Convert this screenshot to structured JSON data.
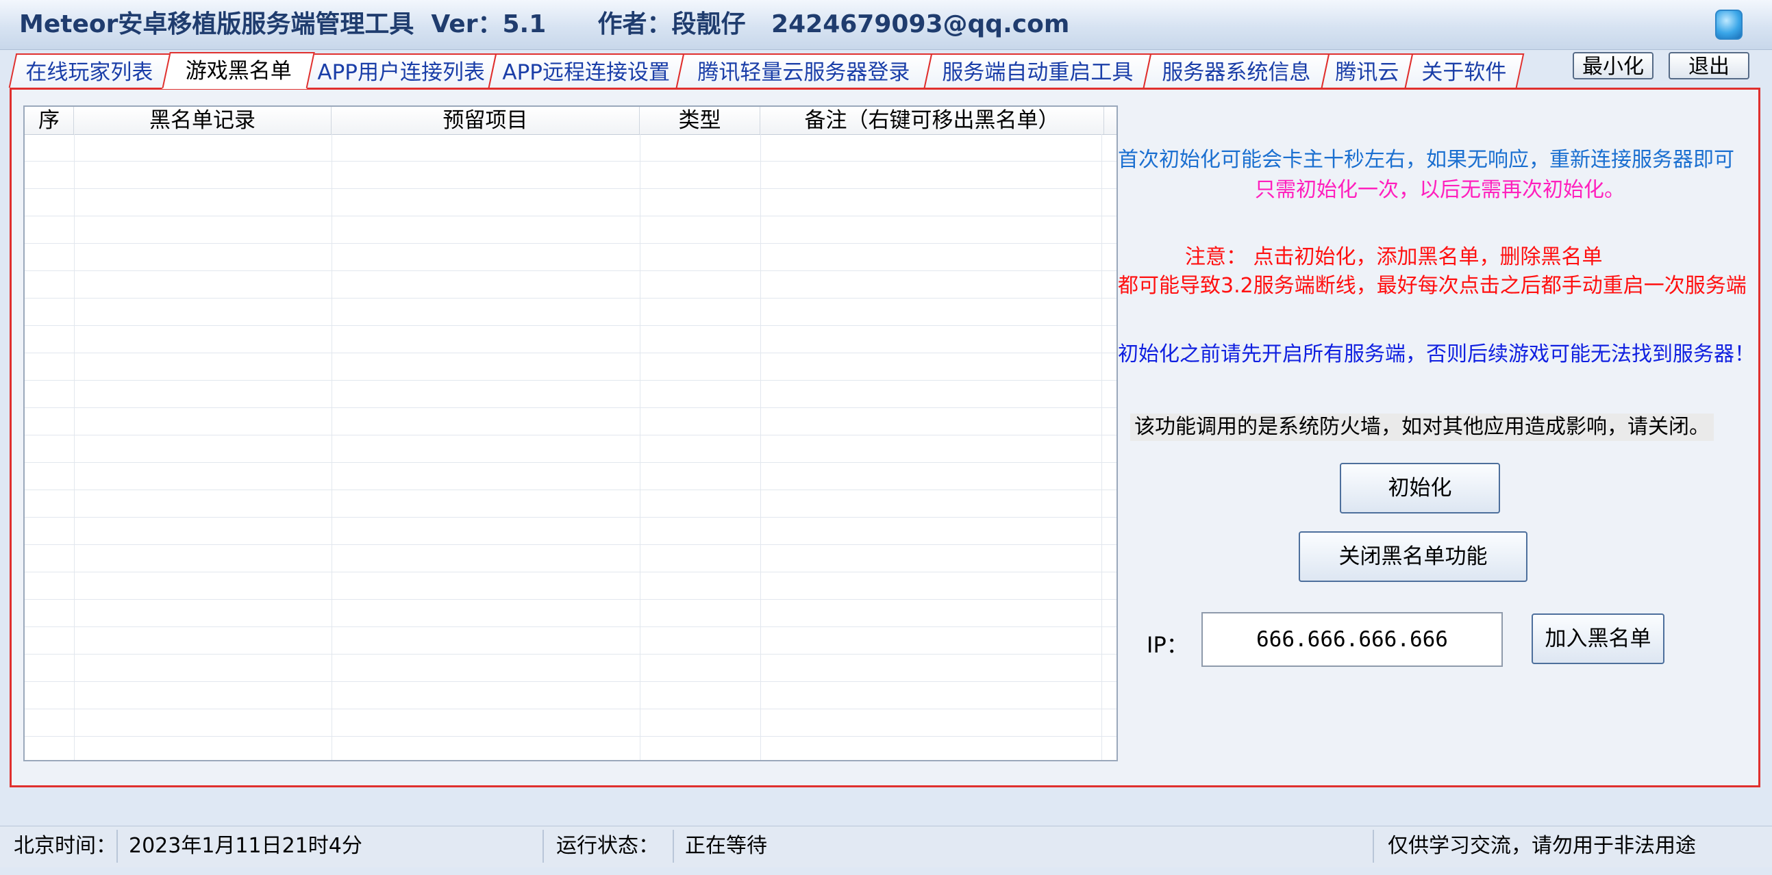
{
  "window": {
    "title": "Meteor安卓移植版服务端管理工具  Ver：5.1      作者：段靓仔   2424679093@qq.com",
    "minimize_label": "最小化",
    "exit_label": "退出",
    "icon": "app-icon"
  },
  "tabs": [
    {
      "label": "在线玩家列表",
      "active": false
    },
    {
      "label": "游戏黑名单",
      "active": true
    },
    {
      "label": "APP用户连接列表",
      "active": false
    },
    {
      "label": "APP远程连接设置",
      "active": false
    },
    {
      "label": "腾讯轻量云服务器登录",
      "active": false
    },
    {
      "label": "服务端自动重启工具",
      "active": false
    },
    {
      "label": "服务器系统信息",
      "active": false
    },
    {
      "label": "腾讯云",
      "active": false
    },
    {
      "label": "关于软件",
      "active": false
    }
  ],
  "table": {
    "columns": [
      "序",
      "黑名单记录",
      "预留项目",
      "类型",
      "备注（右键可移出黑名单）"
    ],
    "rows": []
  },
  "notices": {
    "line1": "首次初始化可能会卡主十秒左右，如果无响应，重新连接服务器即可",
    "line2": "只需初始化一次，以后无需再次初始化。",
    "line3": "注意：  点击初始化，添加黑名单，删除黑名单",
    "line4": "都可能导致3.2服务端断线，最好每次点击之后都手动重启一次服务端",
    "line5": "初始化之前请先开启所有服务端，否则后续游戏可能无法找到服务器！",
    "line6": "该功能调用的是系统防火墙，如对其他应用造成影响，请关闭。"
  },
  "actions": {
    "init_label": "初始化",
    "close_blacklist_label": "关闭黑名单功能",
    "add_blacklist_label": "加入黑名单",
    "ip_label": "IP：",
    "ip_value": "666.666.666.666"
  },
  "status": {
    "time_label": "北京时间：",
    "time_value": "2023年1月11日21时4分",
    "state_label": "运行状态：",
    "state_value": "正在等待",
    "disclaimer": "仅供学习交流，请勿用于非法用途"
  },
  "colors": {
    "tab_border": "#e0302e",
    "notice_blue": "#1a6fd0",
    "notice_pink": "#ff1fbd",
    "notice_red": "#ff1010",
    "notice_darkblue": "#1020e0"
  }
}
